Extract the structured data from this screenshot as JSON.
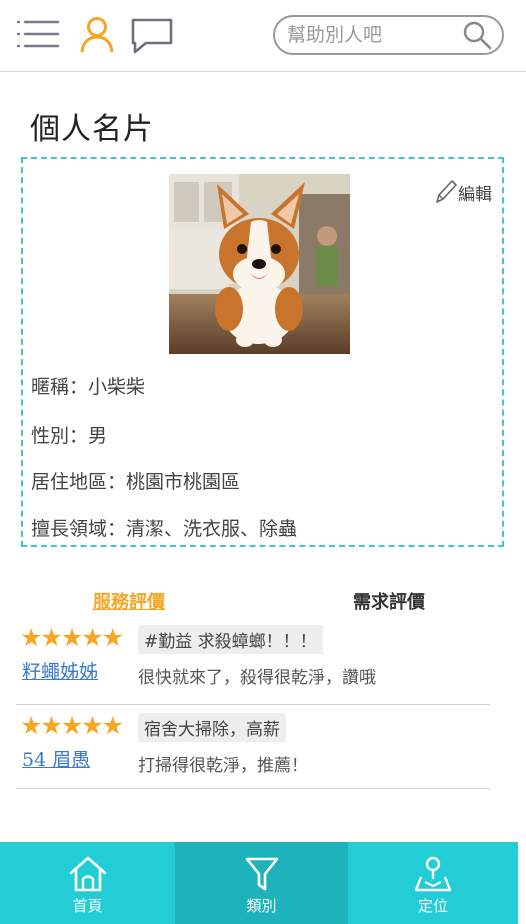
{
  "header": {
    "search": {
      "placeholder": "幫助別人吧",
      "value": ""
    }
  },
  "page_title": "個人名片",
  "profile": {
    "edit_label": "編輯",
    "fields": [
      "暱稱：小柴柴",
      "性別：男",
      "居住地區：桃園市桃園區",
      "擅長領域：清潔、洗衣服、除蟲"
    ]
  },
  "tabs": [
    {
      "label": "服務評價",
      "active": true
    },
    {
      "label": "需求評價",
      "active": false
    }
  ],
  "reviews": [
    {
      "rating": 5,
      "stars": "★★★★★",
      "reviewer": "籽蠅姊姊",
      "tag": "#勤益 求殺蟑螂！！！",
      "comment": "很快就來了，殺得很乾淨，讚哦"
    },
    {
      "rating": 5,
      "stars": "★★★★★",
      "reviewer": "54 眉愚",
      "tag": "宿舍大掃除，高薪",
      "comment": "打掃得很乾淨，推薦！"
    }
  ],
  "bottom_nav": [
    {
      "label": "首頁",
      "icon": "home-icon"
    },
    {
      "label": "類別",
      "icon": "filter-icon"
    },
    {
      "label": "定位",
      "icon": "map-pin-icon"
    }
  ],
  "colors": {
    "accent_orange": "#f5a623",
    "teal": "#22cdd6",
    "teal_dark": "#1eb3bc",
    "card_border": "#45c3d0",
    "link_blue": "#3a7ad0"
  }
}
